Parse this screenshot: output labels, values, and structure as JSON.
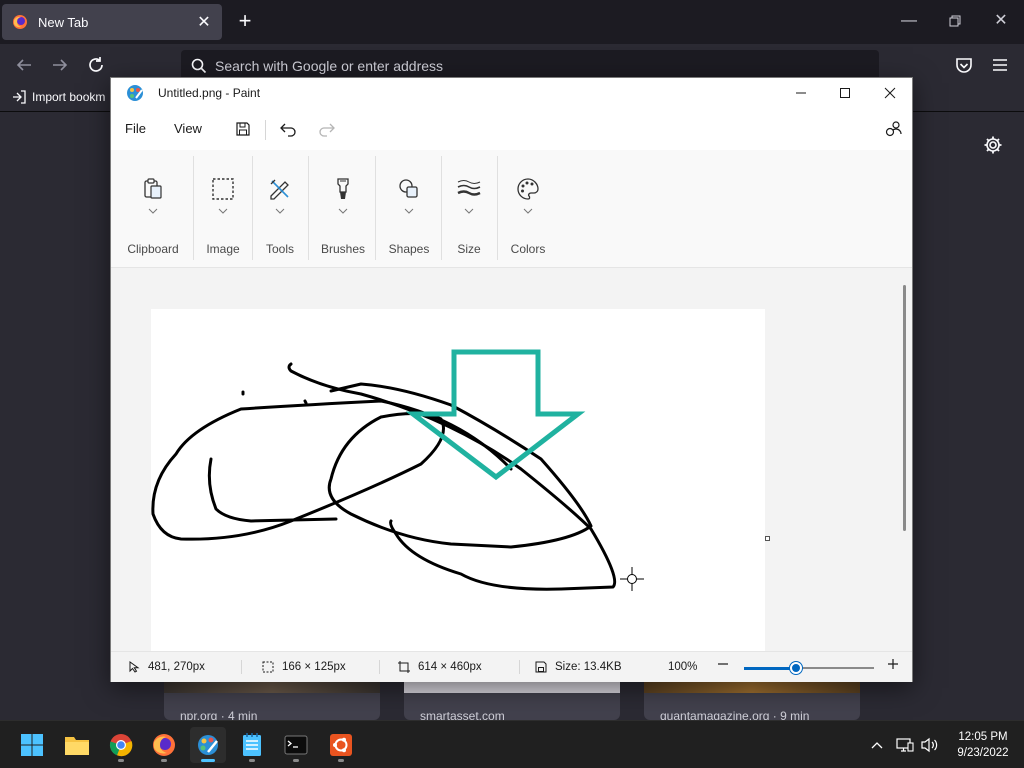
{
  "browser": {
    "tab_title": "New Tab",
    "url_placeholder": "Search with Google or enter address",
    "bookmark_import_label": "Import bookm",
    "tiles": [
      {
        "caption": "npr.org · 4 min"
      },
      {
        "caption": "smartasset.com"
      },
      {
        "caption": "quantamagazine.org · 9 min"
      }
    ]
  },
  "paint": {
    "title": "Untitled.png - Paint",
    "menu": {
      "file": "File",
      "view": "View"
    },
    "ribbon": {
      "groups": [
        {
          "label": "Clipboard",
          "icon": "clipboard-icon"
        },
        {
          "label": "Image",
          "icon": "selection-icon"
        },
        {
          "label": "Tools",
          "icon": "pencil-icon"
        },
        {
          "label": "Brushes",
          "icon": "brush-icon"
        },
        {
          "label": "Shapes",
          "icon": "shapes-icon"
        },
        {
          "label": "Size",
          "icon": "stroke-size-icon"
        },
        {
          "label": "Colors",
          "icon": "palette-icon"
        }
      ]
    },
    "status": {
      "cursor_pos": "481, 270px",
      "selection_size": "166 × 125px",
      "canvas_size": "614 × 460px",
      "file_size": "Size: 13.4KB",
      "zoom_label": "100%",
      "zoom_level": 0.4
    },
    "stroke_color": "#000000",
    "arrow_color": "#20b2a0"
  },
  "taskbar": {
    "time": "12:05 PM",
    "date": "9/23/2022",
    "apps": [
      "start-icon",
      "file-explorer-icon",
      "chrome-icon",
      "firefox-icon",
      "paint-icon",
      "notepad-icon",
      "terminal-icon",
      "ubuntu-icon"
    ]
  }
}
